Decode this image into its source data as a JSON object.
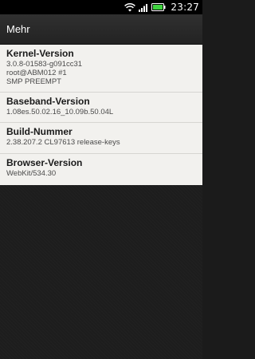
{
  "status_bar": {
    "time": "23:27",
    "icons": [
      "wifi-icon",
      "signal-icon",
      "battery-icon"
    ]
  },
  "title_bar": {
    "title": "Mehr"
  },
  "info": {
    "kernel": {
      "title": "Kernel-Version",
      "lines": [
        "3.0.8-01583-g091cc31",
        "root@ABM012 #1",
        "SMP PREEMPT"
      ]
    },
    "baseband": {
      "title": "Baseband-Version",
      "value": "1.08es.50.02.16_10.09b.50.04L"
    },
    "build": {
      "title": "Build-Nummer",
      "value": "2.38.207.2 CL97613 release-keys"
    },
    "browser": {
      "title": "Browser-Version",
      "value": "WebKit/534.30"
    }
  },
  "colors": {
    "battery": "#3fd33f",
    "background": "#1d1d1d",
    "list_background": "#f2f1ee"
  }
}
